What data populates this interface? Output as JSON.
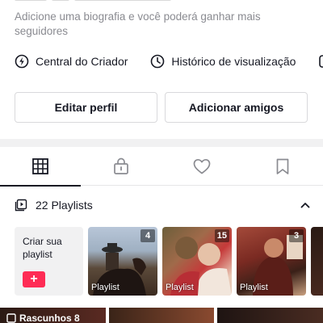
{
  "profile": {
    "bio_prompt": "Adicione uma biografia e você poderá ganhar mais seguidores"
  },
  "quick_links": [
    {
      "label": "Central do Criador",
      "icon": "creator-center-icon"
    },
    {
      "label": "Histórico de visualização",
      "icon": "clock-icon"
    }
  ],
  "buttons": {
    "edit_profile": "Editar perfil",
    "add_friends": "Adicionar amigos"
  },
  "tabs": [
    {
      "name": "videos",
      "icon": "grid-icon",
      "active": true
    },
    {
      "name": "private",
      "icon": "lock-icon",
      "active": false
    },
    {
      "name": "liked",
      "icon": "heart-icon",
      "active": false
    },
    {
      "name": "saved",
      "icon": "bookmark-icon",
      "active": false
    }
  ],
  "playlists": {
    "header": "22 Playlists",
    "create_text": "Criar sua playlist",
    "create_button": "+",
    "items": [
      {
        "label": "Playlist",
        "count": "4"
      },
      {
        "label": "Playlist",
        "count": "15"
      },
      {
        "label": "Playlist",
        "count": "3"
      }
    ]
  },
  "drafts": {
    "label": "Rascunhos 8"
  },
  "colors": {
    "accent": "#fe2c55",
    "text": "#161823",
    "secondary_text": "#8a8b91"
  }
}
